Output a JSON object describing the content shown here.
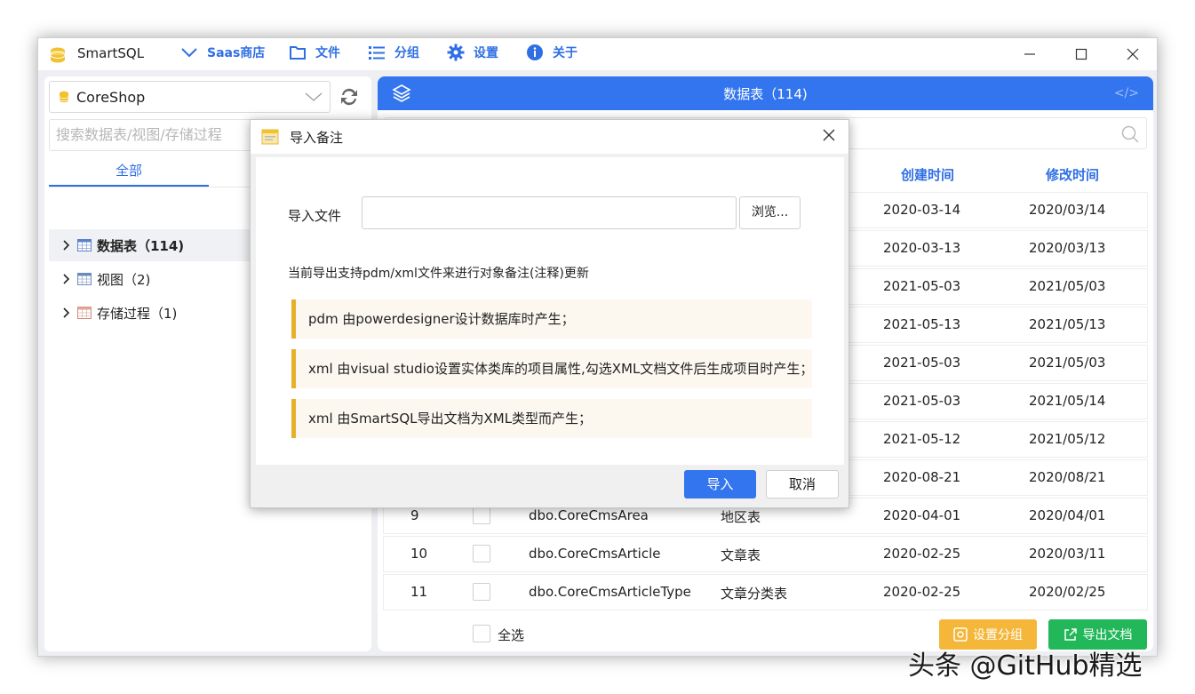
{
  "app": {
    "title": "SmartSQL",
    "menu": [
      {
        "label": "Saas商店",
        "icon": "chevron-down-icon"
      },
      {
        "label": "文件",
        "icon": "folder-icon"
      },
      {
        "label": "分组",
        "icon": "list-icon"
      },
      {
        "label": "设置",
        "icon": "gear-icon"
      },
      {
        "label": "关于",
        "icon": "info-icon"
      }
    ]
  },
  "sidebar": {
    "database": "CoreShop",
    "search_placeholder": "搜索数据表/视图/存储过程",
    "tab_all": "全部",
    "tree": [
      {
        "label": "数据表（114)",
        "selected": true
      },
      {
        "label": "视图（2)",
        "selected": false
      },
      {
        "label": "存储过程（1)",
        "selected": false
      }
    ]
  },
  "main": {
    "header_title": "数据表（114)",
    "code_icon": "</>",
    "columns": {
      "created": "创建时间",
      "modified": "修改时间"
    },
    "rows": [
      {
        "no": "",
        "name": "",
        "comment": "",
        "created": "2020-03-14",
        "modified": "2020/03/14"
      },
      {
        "no": "",
        "name": "",
        "comment": "",
        "created": "2020-03-13",
        "modified": "2020/03/13"
      },
      {
        "no": "",
        "name": "",
        "comment": "",
        "created": "2021-05-03",
        "modified": "2021/05/03"
      },
      {
        "no": "",
        "name": "",
        "comment": "",
        "created": "2021-05-13",
        "modified": "2021/05/13"
      },
      {
        "no": "",
        "name": "",
        "comment": "",
        "created": "2021-05-03",
        "modified": "2021/05/03"
      },
      {
        "no": "",
        "name": "",
        "comment": "",
        "created": "2021-05-03",
        "modified": "2021/05/14"
      },
      {
        "no": "",
        "name": "",
        "comment": "",
        "created": "2021-05-12",
        "modified": "2021/05/12"
      },
      {
        "no": "",
        "name": "",
        "comment": "",
        "created": "2020-08-21",
        "modified": "2020/08/21"
      },
      {
        "no": "9",
        "name": "dbo.CoreCmsArea",
        "comment": "地区表",
        "created": "2020-04-01",
        "modified": "2020/04/01"
      },
      {
        "no": "10",
        "name": "dbo.CoreCmsArticle",
        "comment": "文章表",
        "created": "2020-02-25",
        "modified": "2020/03/11"
      },
      {
        "no": "11",
        "name": "dbo.CoreCmsArticleType",
        "comment": "文章分类表",
        "created": "2020-02-25",
        "modified": "2020/02/25"
      }
    ],
    "select_all": "全选",
    "btn_group": "设置分组",
    "btn_export": "导出文档"
  },
  "dialog": {
    "title": "导入备注",
    "file_label": "导入文件",
    "file_value": "",
    "browse": "浏览...",
    "description": "当前导出支持pdm/xml文件来进行对象备注(注释)更新",
    "notes": [
      "pdm 由powerdesigner设计数据库时产生；",
      "xml 由visual studio设置实体类库的项目属性,勾选XML文档文件后生成项目时产生；",
      "xml 由SmartSQL导出文档为XML类型而产生；"
    ],
    "import": "导入",
    "cancel": "取消"
  },
  "watermark": "头条 @GitHub精选",
  "colors": {
    "accent": "#3375ee",
    "warning": "#f4b73a",
    "success": "#22b85a",
    "note_border": "#e8b02a"
  }
}
